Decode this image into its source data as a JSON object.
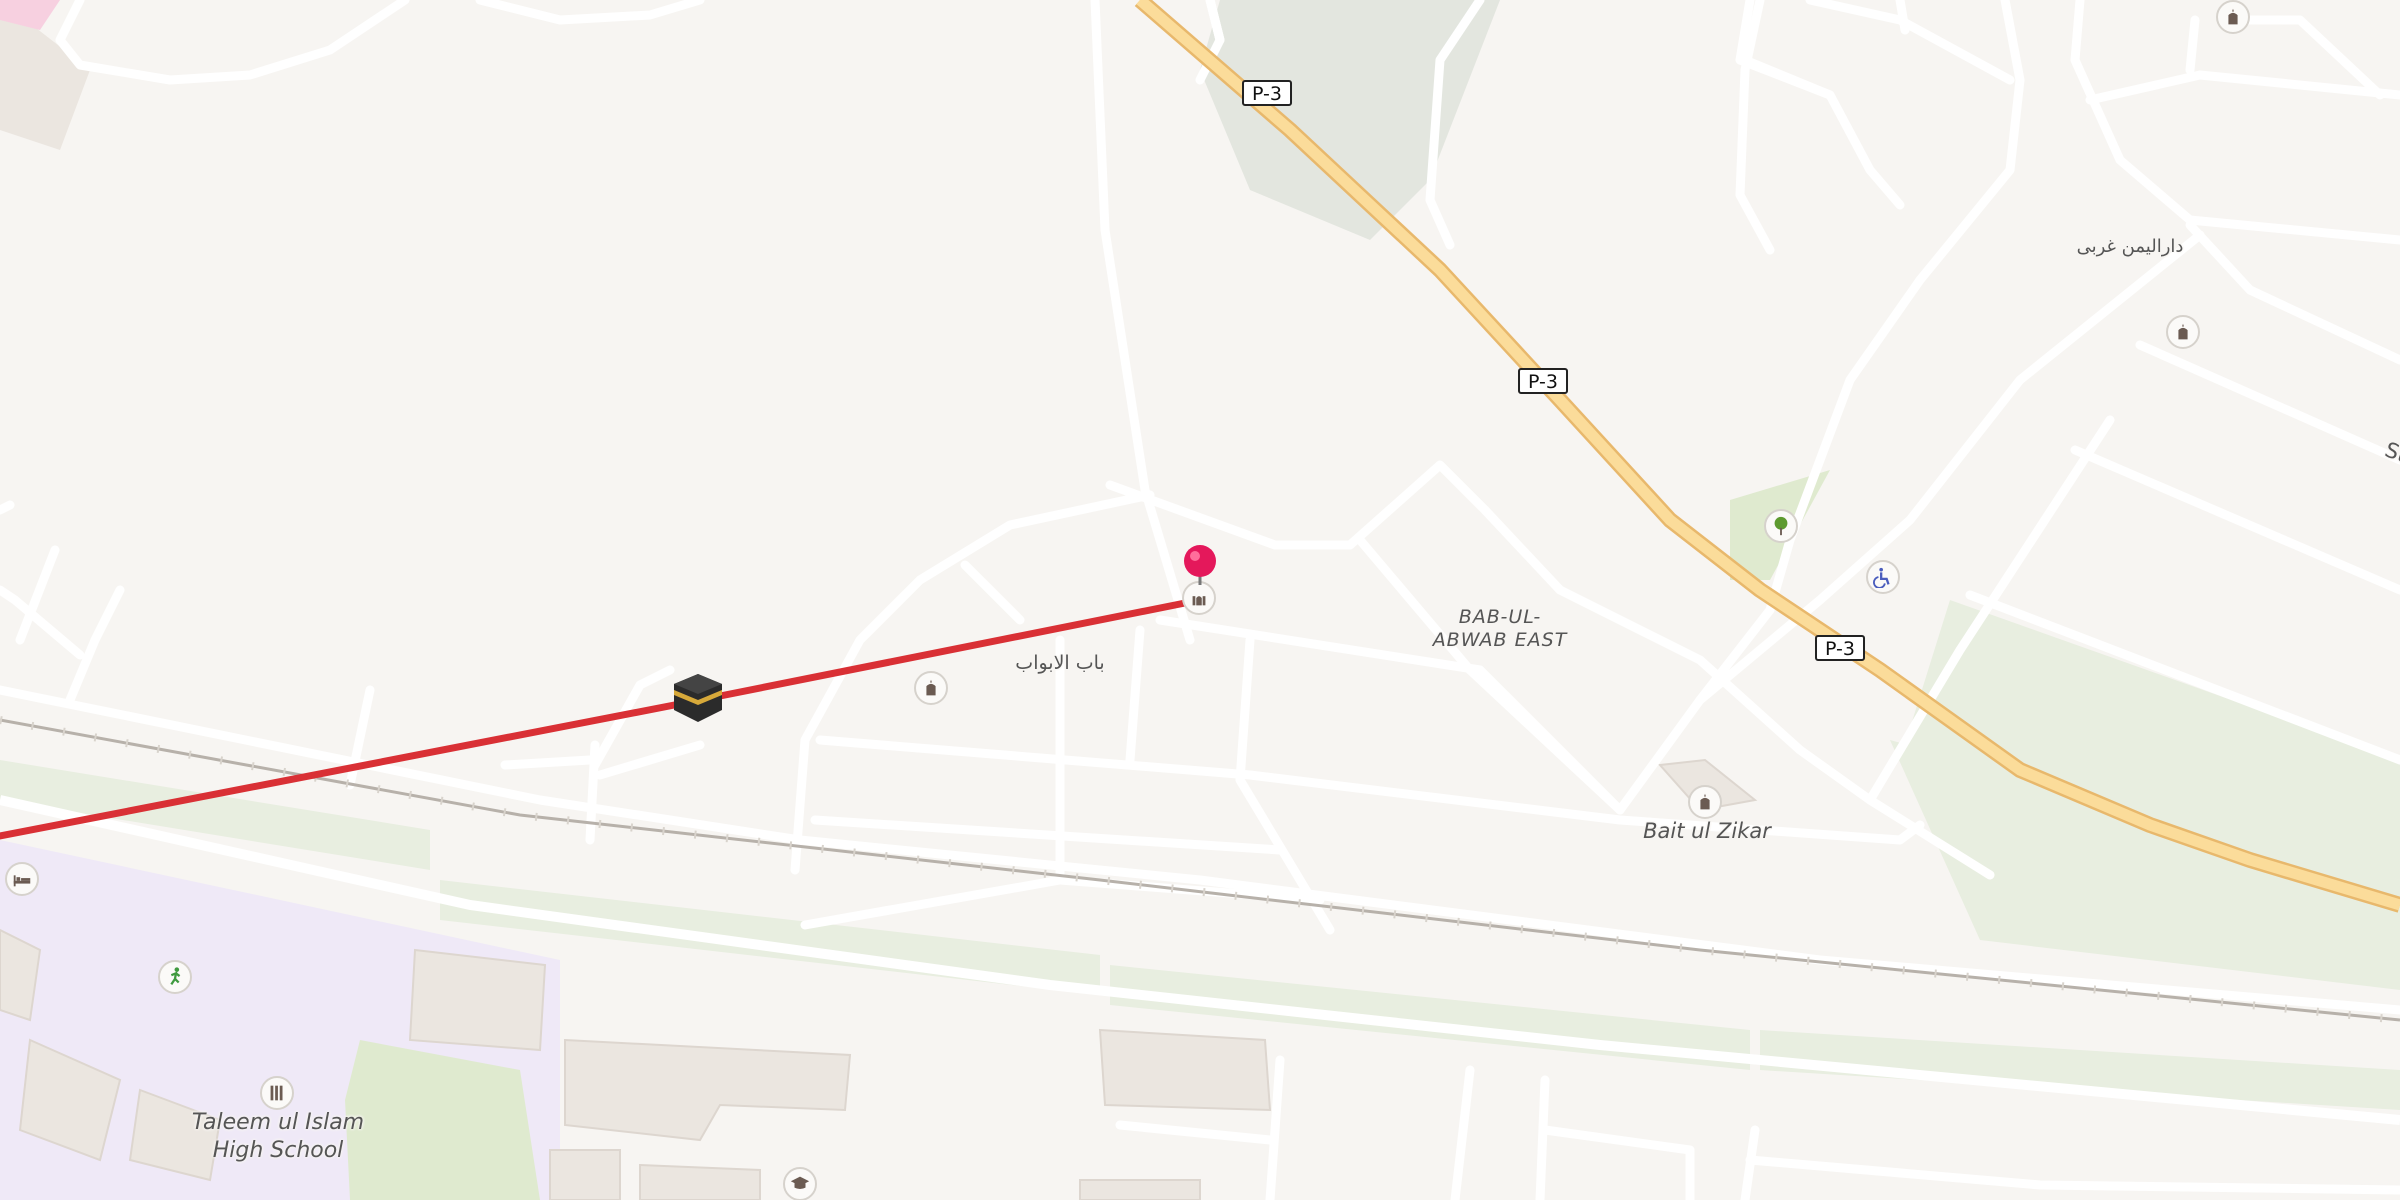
{
  "map": {
    "route_color": "#d93035",
    "highway_color": "#f9d98f",
    "road_color": "#ffffff",
    "background_color": "#f7f5f2"
  },
  "shields": {
    "p3_a": "P-3",
    "p3_b": "P-3",
    "p3_c": "P-3"
  },
  "labels": {
    "bab_arabic": "باب الابواب",
    "bab_abwab_east_1": "BAB-UL-",
    "bab_abwab_east_2": "ABWAB EAST",
    "darul_yemen": "دارالیمن غربی",
    "bait_ul_zikar": "Bait ul Zikar",
    "taleem_1": "Taleem ul Islam",
    "taleem_2": "High School",
    "street_cut": "Str"
  },
  "icons": {
    "destination_marker": "red-pin-marker",
    "kaaba": "kaaba-icon",
    "mosque": "mosque-icon",
    "park": "tree-icon",
    "disability": "wheelchair-icon",
    "hotel": "bed-icon",
    "sport": "running-icon",
    "school": "school-icon",
    "university": "graduation-cap-icon"
  }
}
